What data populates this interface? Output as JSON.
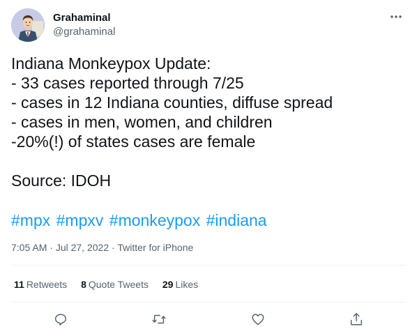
{
  "user": {
    "display_name": "Grahaminal",
    "handle": "@grahaminal",
    "avatar_icon": "cartoon-man-avatar"
  },
  "tweet": {
    "lines": [
      "Indiana Monkeypox Update:",
      "- 33 cases reported through 7/25",
      "- cases in 12 Indiana counties, diffuse spread",
      "- cases in men, women, and children",
      "-20%(!) of states cases are female",
      "",
      "Source: IDOH"
    ],
    "hashtags": [
      "#mpx",
      "#mpxv",
      "#monkeypox",
      "#indiana"
    ]
  },
  "meta": {
    "time": "7:05 AM",
    "separator": "·",
    "date": "Jul 27, 2022",
    "source": "Twitter for iPhone"
  },
  "stats": {
    "retweets_count": "11",
    "retweets_label": "Retweets",
    "quotes_count": "8",
    "quotes_label": "Quote Tweets",
    "likes_count": "29",
    "likes_label": "Likes"
  },
  "actions": {
    "reply_icon": "reply-icon",
    "retweet_icon": "retweet-icon",
    "like_icon": "like-icon",
    "share_icon": "share-icon"
  },
  "colors": {
    "accent": "#1d9bf0",
    "text": "#0f1419",
    "secondary": "#536471",
    "divider": "#eff3f4"
  }
}
